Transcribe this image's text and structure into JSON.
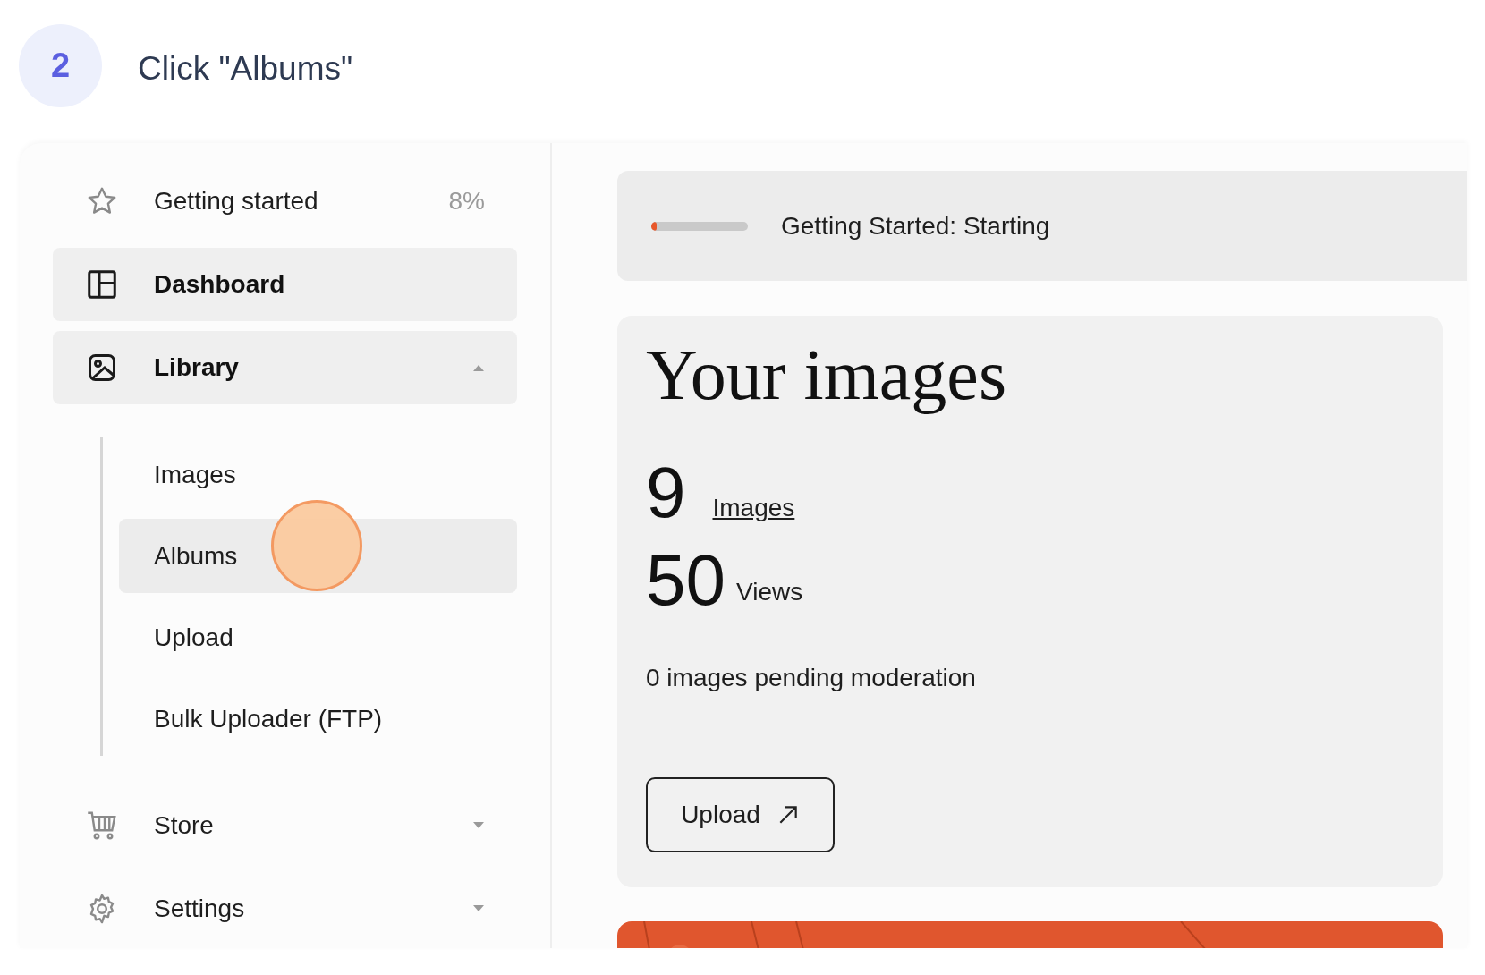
{
  "step": {
    "number": "2",
    "text": "Click \"Albums\""
  },
  "sidebar": {
    "items": [
      {
        "label": "Getting started",
        "badge": "8%",
        "selected": false
      },
      {
        "label": "Dashboard",
        "selected": true
      },
      {
        "label": "Library",
        "selected": true,
        "expanded": true,
        "children": [
          {
            "label": "Images",
            "selected": false
          },
          {
            "label": "Albums",
            "selected": true
          },
          {
            "label": "Upload",
            "selected": false
          },
          {
            "label": "Bulk Uploader (FTP)",
            "selected": false
          }
        ]
      },
      {
        "label": "Store",
        "selected": false,
        "expanded": false
      },
      {
        "label": "Settings",
        "selected": false,
        "expanded": false
      }
    ]
  },
  "progress": {
    "label": "Getting Started: Starting",
    "level": 0.06
  },
  "card": {
    "title": "Your images",
    "stats": [
      {
        "value": "9",
        "label": "Images",
        "kind": "link"
      },
      {
        "value": "50",
        "label": "Views",
        "kind": "text"
      }
    ],
    "note": "0 images pending moderation",
    "button": "Upload"
  }
}
